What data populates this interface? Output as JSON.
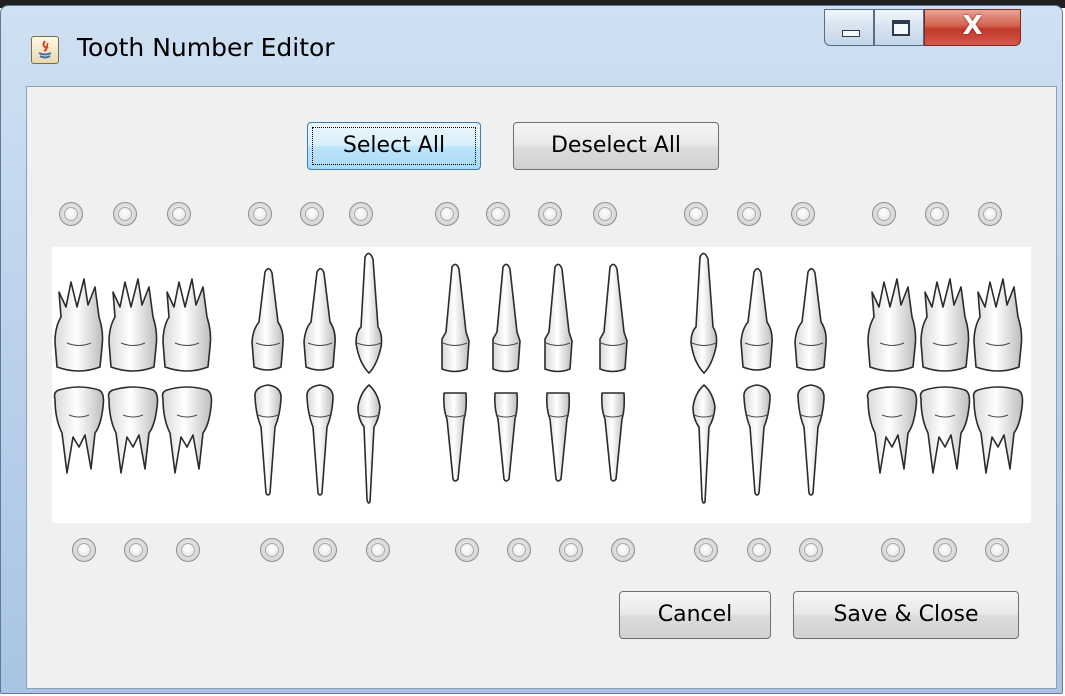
{
  "window": {
    "title": "Tooth Number Editor",
    "close_glyph": "X",
    "icons": [
      "java-app-icon",
      "minimize-icon",
      "maximize-icon",
      "close-icon"
    ]
  },
  "toolbar": {
    "select_all": "Select All",
    "deselect_all": "Deselect All"
  },
  "actions": {
    "cancel": "Cancel",
    "save_close": "Save & Close"
  },
  "upper_teeth": [
    {
      "type": "molar",
      "selected": false
    },
    {
      "type": "molar",
      "selected": false
    },
    {
      "type": "molar",
      "selected": false
    },
    {
      "type": "premolar",
      "selected": false
    },
    {
      "type": "premolar",
      "selected": false
    },
    {
      "type": "canine",
      "selected": false
    },
    {
      "type": "incisor",
      "selected": false
    },
    {
      "type": "incisor",
      "selected": false
    },
    {
      "type": "incisor",
      "selected": false
    },
    {
      "type": "incisor",
      "selected": false
    },
    {
      "type": "canine",
      "selected": false
    },
    {
      "type": "premolar",
      "selected": false
    },
    {
      "type": "premolar",
      "selected": false
    },
    {
      "type": "molar",
      "selected": false
    },
    {
      "type": "molar",
      "selected": false
    },
    {
      "type": "molar",
      "selected": false
    }
  ],
  "lower_teeth": [
    {
      "type": "molar",
      "selected": false
    },
    {
      "type": "molar",
      "selected": false
    },
    {
      "type": "molar",
      "selected": false
    },
    {
      "type": "premolar",
      "selected": false
    },
    {
      "type": "premolar",
      "selected": false
    },
    {
      "type": "canine",
      "selected": false
    },
    {
      "type": "incisor",
      "selected": false
    },
    {
      "type": "incisor",
      "selected": false
    },
    {
      "type": "incisor",
      "selected": false
    },
    {
      "type": "incisor",
      "selected": false
    },
    {
      "type": "canine",
      "selected": false
    },
    {
      "type": "premolar",
      "selected": false
    },
    {
      "type": "premolar",
      "selected": false
    },
    {
      "type": "molar",
      "selected": false
    },
    {
      "type": "molar",
      "selected": false
    },
    {
      "type": "molar",
      "selected": false
    }
  ]
}
